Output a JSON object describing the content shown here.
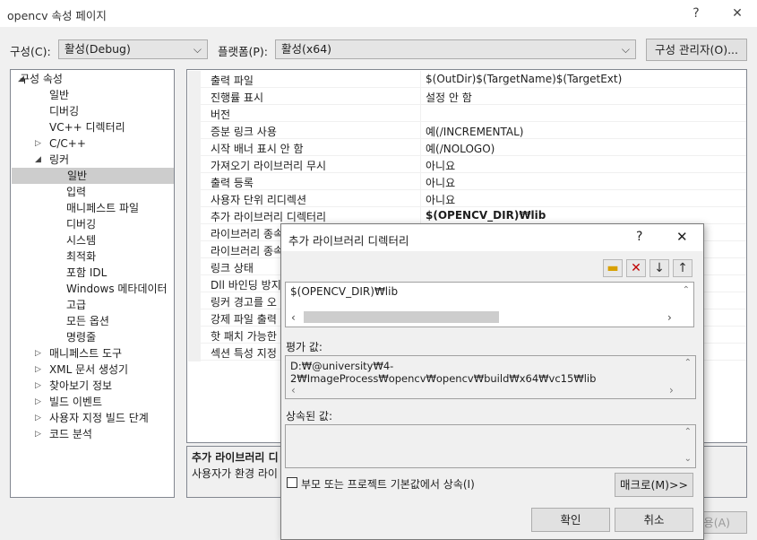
{
  "window": {
    "title": "opencv 속성 페이지",
    "help": "?",
    "close": "✕"
  },
  "toolbar": {
    "config_label": "구성(C):",
    "config_value": "활성(Debug)",
    "platform_label": "플랫폼(P):",
    "platform_value": "활성(x64)",
    "config_manager": "구성 관리자(O)..."
  },
  "tree": {
    "items": [
      {
        "label": "구성 속성",
        "expander": "◢"
      },
      {
        "label": "일반"
      },
      {
        "label": "디버깅"
      },
      {
        "label": "VC++ 디렉터리"
      },
      {
        "label": "C/C++",
        "expander": "▷"
      },
      {
        "label": "링커",
        "expander": "◢"
      },
      {
        "label": "일반",
        "selected": true
      },
      {
        "label": "입력"
      },
      {
        "label": "매니페스트 파일"
      },
      {
        "label": "디버깅"
      },
      {
        "label": "시스템"
      },
      {
        "label": "최적화"
      },
      {
        "label": "포함 IDL"
      },
      {
        "label": "Windows 메타데이터"
      },
      {
        "label": "고급"
      },
      {
        "label": "모든 옵션"
      },
      {
        "label": "명령줄"
      },
      {
        "label": "매니페스트 도구",
        "expander": "▷"
      },
      {
        "label": "XML 문서 생성기",
        "expander": "▷"
      },
      {
        "label": "찾아보기 정보",
        "expander": "▷"
      },
      {
        "label": "빌드 이벤트",
        "expander": "▷"
      },
      {
        "label": "사용자 지정 빌드 단계",
        "expander": "▷"
      },
      {
        "label": "코드 분석",
        "expander": "▷"
      }
    ]
  },
  "grid": {
    "rows": [
      {
        "name": "출력 파일",
        "value": "$(OutDir)$(TargetName)$(TargetExt)"
      },
      {
        "name": "진행률 표시",
        "value": "설정 안 함"
      },
      {
        "name": "버전",
        "value": ""
      },
      {
        "name": "증분 링크 사용",
        "value": "예(/INCREMENTAL)"
      },
      {
        "name": "시작 배너 표시 안 함",
        "value": "예(/NOLOGO)"
      },
      {
        "name": "가져오기 라이브러리 무시",
        "value": "아니요"
      },
      {
        "name": "출력 등록",
        "value": "아니요"
      },
      {
        "name": "사용자 단위 리디렉션",
        "value": "아니요"
      },
      {
        "name": "추가 라이브러리 디렉터리",
        "value": "$(OPENCV_DIR)₩lib",
        "bold": true
      },
      {
        "name": "라이브러리 종속",
        "value": ""
      },
      {
        "name": "라이브러리 종속",
        "value": ""
      },
      {
        "name": "링크 상태",
        "value": ""
      },
      {
        "name": "Dll 바인딩 방지",
        "value": ""
      },
      {
        "name": "링커 경고를 오",
        "value": ""
      },
      {
        "name": "강제 파일 출력",
        "value": ""
      },
      {
        "name": "핫 패치 가능한",
        "value": ""
      },
      {
        "name": "섹션 특성 지정",
        "value": ""
      }
    ]
  },
  "description": {
    "title": "추가 라이브러리 디",
    "text": "사용자가 환경 라이"
  },
  "bottom_button": "용(A)",
  "dialog": {
    "title": "추가 라이브러리 디렉터리",
    "help": "?",
    "close": "✕",
    "tools": {
      "new_folder": "📁",
      "delete": "✕",
      "down": "🡇",
      "up": "🡅"
    },
    "list_value": "$(OPENCV_DIR)₩lib",
    "evaluated_label": "평가 값:",
    "evaluated_value": "D:₩@university₩4-2₩ImageProcess₩opencv₩opencv₩build₩x64₩vc15₩lib",
    "inherited_label": "상속된 값:",
    "inherit_checkbox": "부모 또는 프로젝트 기본값에서 상속(I)",
    "macro_button": "매크로(M)>>",
    "ok_button": "확인",
    "cancel_button": "취소"
  }
}
